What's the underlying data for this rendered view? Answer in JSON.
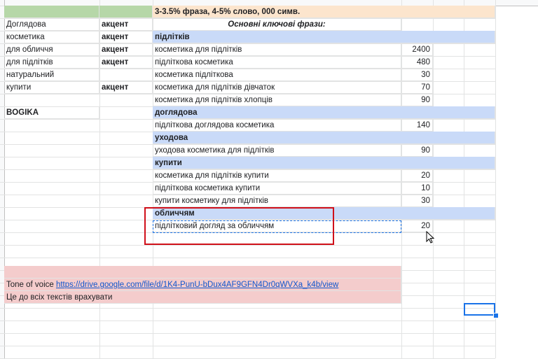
{
  "colors": {
    "green_fill": "#b6d7a8",
    "peach_fill": "#fce5cd",
    "blue_fill": "#c9daf8",
    "pink_fill": "#f4cccc",
    "highlight_red": "#d0101a",
    "selection_blue": "#1a73e8"
  },
  "header": {
    "instruction": "3-3.5% фраза, 4-5% слово, 000 симв.",
    "key_phrases_title": "Основні ключові фрази:"
  },
  "words": [
    {
      "word": "Доглядова",
      "accent": "акцент"
    },
    {
      "word": "косметика",
      "accent": "акцент"
    },
    {
      "word": "для обличчя",
      "accent": "акцент"
    },
    {
      "word": "для підлітків",
      "accent": "акцент"
    },
    {
      "word": "натуральний",
      "accent": ""
    },
    {
      "word": "купити",
      "accent": "акцент"
    }
  ],
  "brand": "BOGIKA",
  "groups": [
    {
      "name": "підлітків",
      "phrases": [
        {
          "text": "косметика для підлітків",
          "count": "2400"
        },
        {
          "text": "підліткова косметика",
          "count": "480"
        },
        {
          "text": "косметика підліткова",
          "count": "30"
        },
        {
          "text": "косметика для підлітків дівчаток",
          "count": "70"
        },
        {
          "text": "косметика для підлітків хлопців",
          "count": "90"
        }
      ]
    },
    {
      "name": "доглядова",
      "phrases": [
        {
          "text": "підліткова доглядова косметика",
          "count": "140"
        }
      ]
    },
    {
      "name": "уходова",
      "phrases": [
        {
          "text": "уходова косметика для підлітків",
          "count": "90"
        }
      ]
    },
    {
      "name": "купити",
      "phrases": [
        {
          "text": "косметика для підлітків купити",
          "count": "20"
        },
        {
          "text": "підліткова косметика купити",
          "count": "10"
        },
        {
          "text": "купити косметику для підлітків",
          "count": "30"
        }
      ]
    },
    {
      "name": "обличчям",
      "phrases": [
        {
          "text": "підлітковий догляд за обличчям",
          "count": "20"
        }
      ]
    }
  ],
  "notes": {
    "tone_label": "Tone of voice",
    "tone_link": "https://drive.google.com/file/d/1K4-PunU-bDux4AF9GFN4Dr0qWVXa_k4b/view",
    "apply_text": "Це до всіх текстів врахувати"
  }
}
